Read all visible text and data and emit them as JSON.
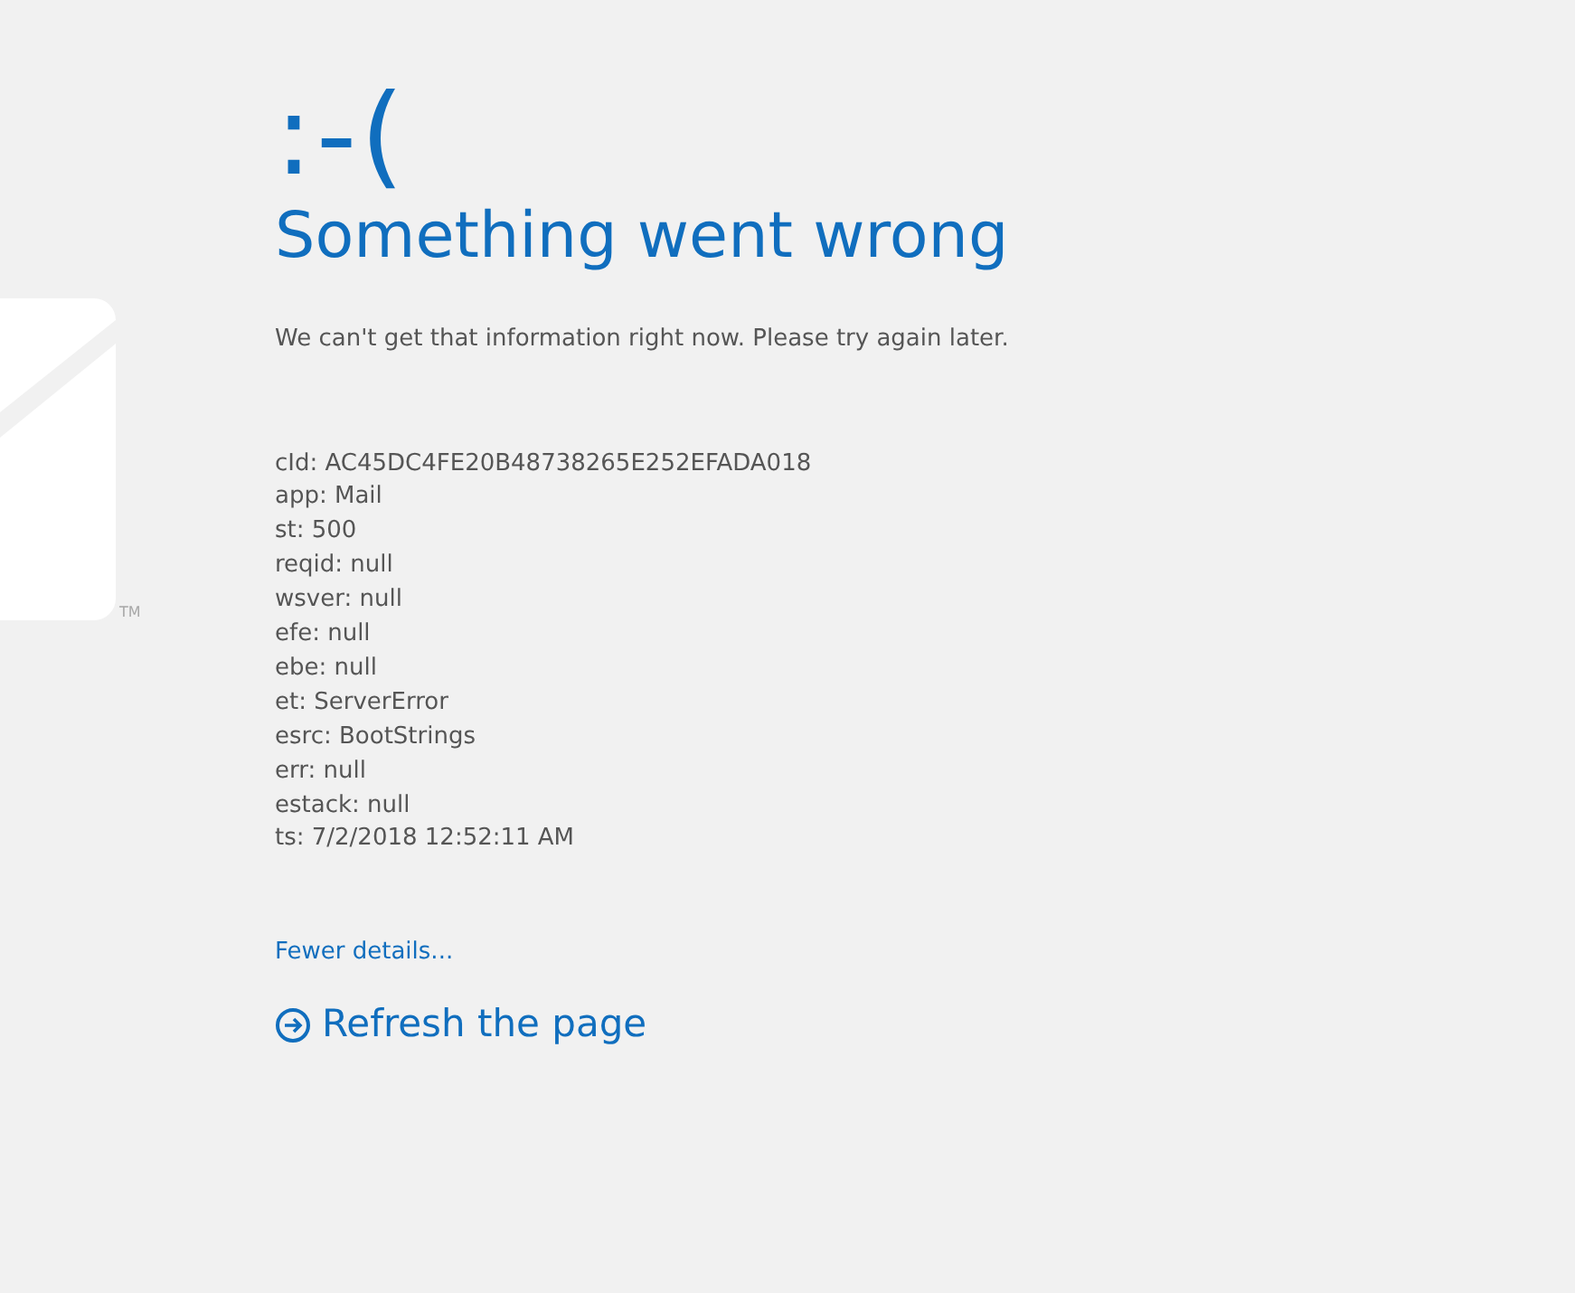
{
  "logo": {
    "trademark": "TM"
  },
  "emoticon": ":-(",
  "heading": "Something went wrong",
  "message": "We can't get that information right now. Please try again later.",
  "details": [
    "cId: AC45DC4FE20B48738265E252EFADA018",
    "app: Mail",
    "st: 500",
    "reqid: null",
    "wsver: null",
    "efe: null",
    "ebe: null",
    "et: ServerError",
    "esrc: BootStrings",
    "err: null",
    "estack: null",
    "ts: 7/2/2018 12:52:11 AM"
  ],
  "details_toggle": "Fewer details...",
  "refresh_link": "Refresh the page"
}
